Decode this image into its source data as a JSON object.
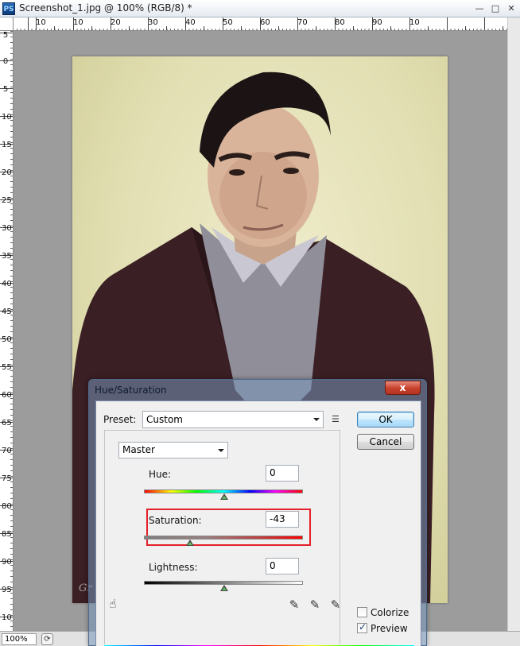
{
  "window": {
    "app_icon": "PS",
    "title": "Screenshot_1.jpg @ 100% (RGB/8) *",
    "controls": {
      "minimize": "—",
      "restore": "□",
      "close": "✕"
    }
  },
  "ruler": {
    "horizontal": [
      "10",
      "10",
      "20",
      "30",
      "40",
      "50",
      "60",
      "70",
      "80",
      "90",
      "10"
    ],
    "vertical": [
      "5",
      "0",
      "5",
      "10",
      "15",
      "20",
      "25",
      "30",
      "35",
      "40",
      "45",
      "50",
      "55",
      "60",
      "65",
      "70",
      "75",
      "80",
      "85",
      "90",
      "95",
      "10"
    ]
  },
  "status": {
    "zoom": "100%",
    "icon": "status-arrow-icon"
  },
  "canvas": {
    "signature": "Gr"
  },
  "dialog": {
    "title": "Hue/Saturation",
    "close_label": "x",
    "preset_label": "Preset:",
    "preset_value": "Custom",
    "ok_label": "OK",
    "cancel_label": "Cancel",
    "channel_value": "Master",
    "hue_label": "Hue:",
    "hue_value": "0",
    "saturation_label": "Saturation:",
    "saturation_value": "-43",
    "lightness_label": "Lightness:",
    "lightness_value": "0",
    "colorize_label": "Colorize",
    "colorize_checked": false,
    "preview_label": "Preview",
    "preview_checked": true,
    "icons": [
      "hand-adjust-icon",
      "eyedropper-icon",
      "eyedropper-plus-icon",
      "eyedropper-minus-icon",
      "preset-options-icon"
    ]
  }
}
